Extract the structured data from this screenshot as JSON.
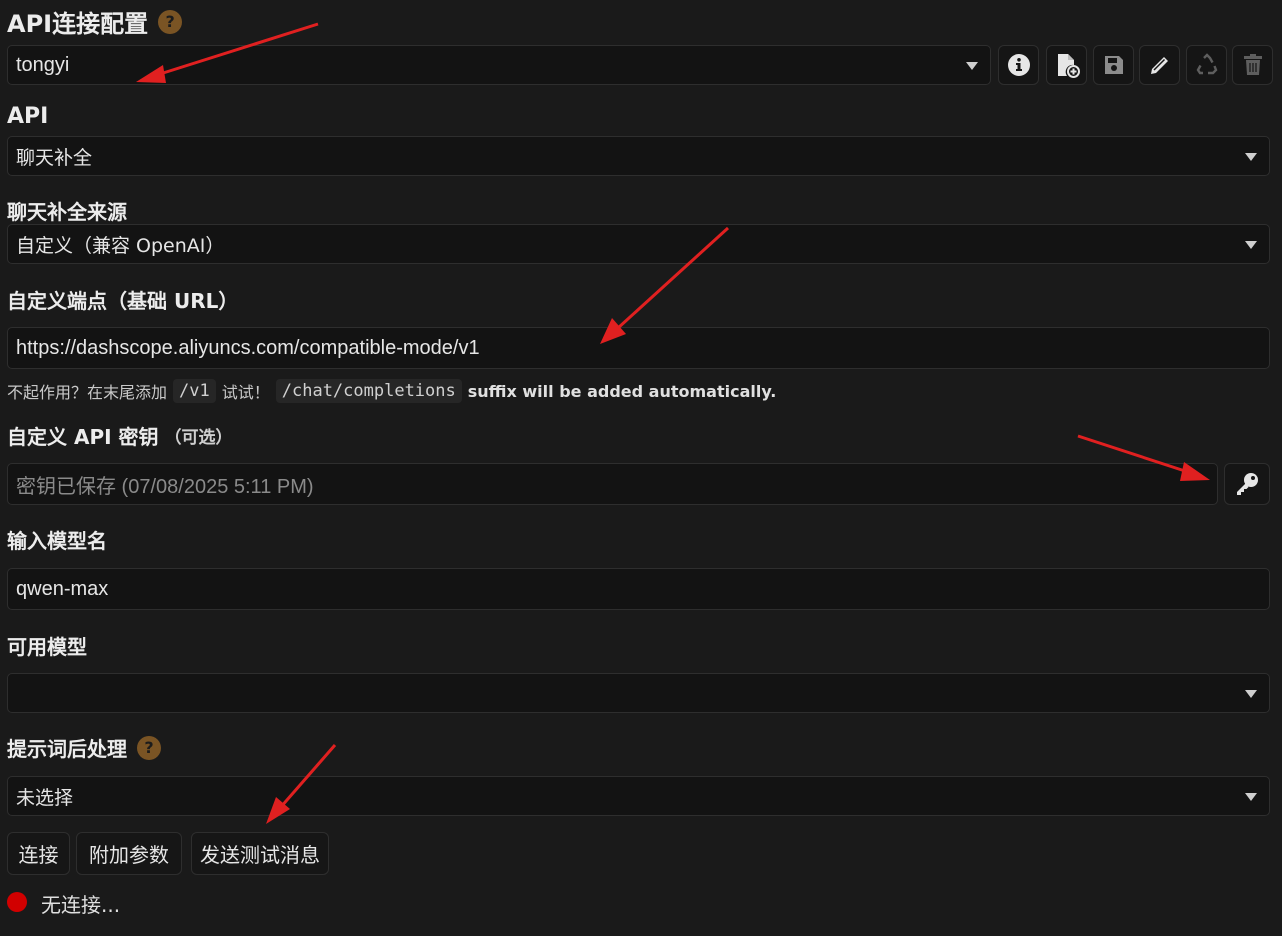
{
  "api_connection": {
    "title": "API连接配置",
    "help": "?",
    "profile_value": "tongyi"
  },
  "api": {
    "label": "API",
    "value": "聊天补全"
  },
  "source": {
    "label": "聊天补全来源",
    "value": "自定义（兼容 OpenAI）"
  },
  "endpoint": {
    "label": "自定义端点（基础 URL）",
    "value": "https://dashscope.aliyuncs.com/compatible-mode/v1",
    "hint_prefix": "不起作用？在末尾添加",
    "hint_code1": "/v1",
    "hint_mid": "试试！",
    "hint_code2": "/chat/completions",
    "hint_suffix": "suffix will be added automatically."
  },
  "api_key": {
    "label": "自定义 API 密钥",
    "optional": "（可选）",
    "placeholder": "密钥已保存 (07/08/2025 5:11 PM)"
  },
  "model_name": {
    "label": "输入模型名",
    "value": "qwen-max"
  },
  "available_models": {
    "label": "可用模型",
    "value": ""
  },
  "post_processing": {
    "label": "提示词后处理",
    "help": "?",
    "value": "未选择"
  },
  "buttons": {
    "connect": "连接",
    "extra_params": "附加参数",
    "send_test": "发送测试消息"
  },
  "status": {
    "text": "无连接...",
    "color": "#d10000"
  },
  "toolbar_icons": [
    "info-icon",
    "new-file-icon",
    "save-icon",
    "edit-icon",
    "recycle-icon",
    "trash-icon"
  ],
  "colors": {
    "background": "#1a1a1a",
    "help_badge": "#7a5424",
    "annotation_arrow": "#e02020"
  }
}
